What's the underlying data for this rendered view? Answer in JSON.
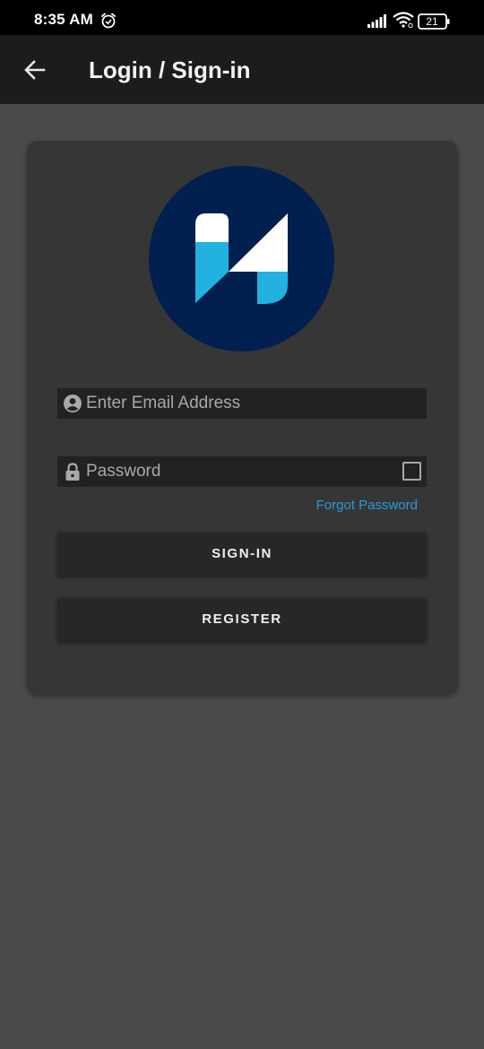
{
  "status_bar": {
    "time": "8:35 AM",
    "battery_level": "21",
    "icons": [
      "alarm-icon",
      "signal-icon",
      "wifi-icon",
      "battery-icon"
    ]
  },
  "app_bar": {
    "title": "Login / Sign-in",
    "back_icon": "arrow-left-icon"
  },
  "login_form": {
    "email_placeholder": "Enter Email Address",
    "email_value": "",
    "email_icon": "account-circle-icon",
    "password_placeholder": "Password",
    "password_value": "",
    "password_icon": "lock-icon",
    "show_password_checked": false,
    "forgot_password_label": "Forgot Password",
    "signin_label": "SIGN-IN",
    "register_label": "REGISTER"
  },
  "colors": {
    "page_background": "#4a4a4a",
    "app_bar": "#1c1c1c",
    "card": "#363636",
    "field": "#222222",
    "button": "#272727",
    "link": "#2a9ad6",
    "logo_circle": "#02204f",
    "logo_blue": "#23b1e0",
    "logo_white": "#ffffff"
  }
}
